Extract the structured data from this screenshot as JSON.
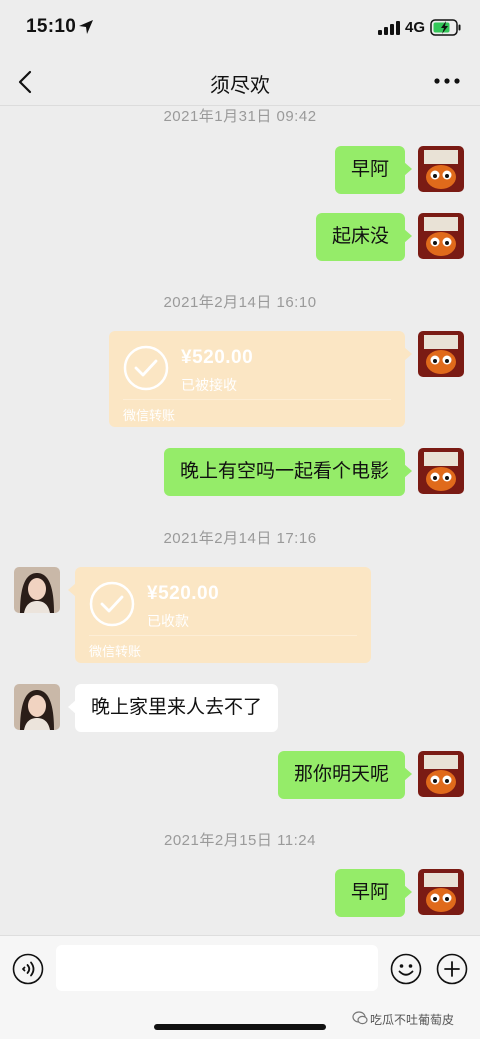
{
  "status_bar": {
    "time": "15:10",
    "network": "4G"
  },
  "header": {
    "title": "须尽欢"
  },
  "timestamps": {
    "t1": "2021年1月31日 09:42",
    "t2": "2021年2月14日 16:10",
    "t3": "2021年2月14日 17:16",
    "t4": "2021年2月15日 11:24"
  },
  "messages": {
    "m1": "早阿",
    "m2": "起床没",
    "m4": "晚上有空吗一起看个电影",
    "m6": "晚上家里来人去不了",
    "m7": "那你明天呢",
    "m8": "早阿"
  },
  "transfers": {
    "tr1": {
      "amount": "¥520.00",
      "status": "已被接收",
      "footer": "微信转账"
    },
    "tr2": {
      "amount": "¥520.00",
      "status": "已收款",
      "footer": "微信转账"
    }
  },
  "input": {
    "placeholder": ""
  },
  "watermark": {
    "text": "吃瓜不吐葡萄皮"
  },
  "colors": {
    "sent_bubble": "#95ec69",
    "received_bubble": "#ffffff",
    "transfer_bg": "#fbe6c4",
    "background": "#ededed"
  },
  "icons": {
    "back": "chevron-left-icon",
    "more": "more-icon",
    "voice": "voice-icon",
    "emoji": "emoji-icon",
    "plus": "plus-icon",
    "check": "check-circle-icon"
  }
}
